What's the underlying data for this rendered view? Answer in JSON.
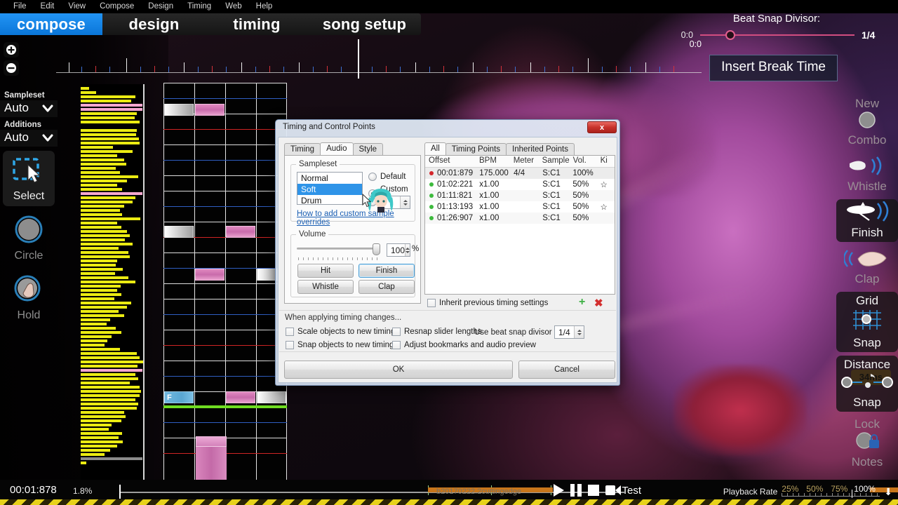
{
  "menubar": {
    "items": [
      "File",
      "Edit",
      "View",
      "Compose",
      "Design",
      "Timing",
      "Web",
      "Help"
    ]
  },
  "modes": [
    {
      "label": "compose",
      "active": true
    },
    {
      "label": "design",
      "active": false
    },
    {
      "label": "timing",
      "active": false
    },
    {
      "label": "song setup",
      "active": false
    }
  ],
  "timeline": {
    "current_time_label": "0:0"
  },
  "beat_snap": {
    "title": "Beat Snap Divisor:",
    "left_label": "0:0",
    "value": "1/4"
  },
  "break_button": {
    "label": "Insert Break Time"
  },
  "left_toolbar": {
    "sampleset_label": "Sampleset",
    "sampleset_value": "Auto",
    "additions_label": "Additions",
    "additions_value": "Auto",
    "tools": [
      {
        "name": "Select",
        "active": true
      },
      {
        "name": "Circle",
        "active": false
      },
      {
        "name": "Hold",
        "active": false
      }
    ]
  },
  "right_toolbar": {
    "items": [
      {
        "line1": "New",
        "line2": "Combo",
        "active": false
      },
      {
        "line1": "",
        "line2": "Whistle",
        "active": false
      },
      {
        "line1": "",
        "line2": "Finish",
        "active": true
      },
      {
        "line1": "",
        "line2": "Clap",
        "active": false
      },
      {
        "line1": "Grid",
        "line2": "Snap",
        "active": true
      },
      {
        "line1": "Distance",
        "line2": "Snap",
        "active": true
      },
      {
        "line1": "Lock",
        "line2": "Notes",
        "active": false
      }
    ],
    "latency_badge": "34ms"
  },
  "playfield": {
    "hold_note_label": "F"
  },
  "dialog": {
    "title": "Timing and Control Points",
    "close_label": "x",
    "left_tabs": [
      {
        "label": "Timing",
        "active": false
      },
      {
        "label": "Audio",
        "active": true
      },
      {
        "label": "Style",
        "active": false
      }
    ],
    "sampleset": {
      "legend": "Sampleset",
      "list": [
        {
          "label": "Normal",
          "selected": false
        },
        {
          "label": "Soft",
          "selected": true
        },
        {
          "label": "Drum",
          "selected": false
        }
      ],
      "radios": [
        {
          "label": "Default",
          "selected": false
        },
        {
          "label": "Custom 1",
          "selected": true
        },
        {
          "label": "",
          "selected": false
        }
      ],
      "help_link": "How to add custom sample overrides"
    },
    "volume": {
      "legend": "Volume",
      "value": "100",
      "unit": "%",
      "buttons": [
        {
          "label": "Hit",
          "highlighted": false
        },
        {
          "label": "Finish",
          "highlighted": true
        },
        {
          "label": "Whistle",
          "highlighted": false
        },
        {
          "label": "Clap",
          "highlighted": false
        }
      ]
    },
    "right_tabs": [
      {
        "label": "All",
        "active": true
      },
      {
        "label": "Timing Points",
        "active": false
      },
      {
        "label": "Inherited Points",
        "active": false
      }
    ],
    "table": {
      "headers": [
        "Offset",
        "BPM",
        "Meter",
        "Sample",
        "Vol.",
        "Ki"
      ],
      "rows": [
        {
          "marker": "red",
          "offset": "00:01:879",
          "bpm": "175.000",
          "meter": "4/4",
          "sample": "S:C1",
          "vol": "100%",
          "ki": "",
          "selected": true
        },
        {
          "marker": "green",
          "offset": "01:02:221",
          "bpm": "x1.00",
          "meter": "",
          "sample": "S:C1",
          "vol": "50%",
          "ki": "☆",
          "selected": false
        },
        {
          "marker": "green",
          "offset": "01:11:821",
          "bpm": "x1.00",
          "meter": "",
          "sample": "S:C1",
          "vol": "50%",
          "ki": "",
          "selected": false
        },
        {
          "marker": "green",
          "offset": "01:13:193",
          "bpm": "x1.00",
          "meter": "",
          "sample": "S:C1",
          "vol": "50%",
          "ki": "☆",
          "selected": false
        },
        {
          "marker": "green",
          "offset": "01:26:907",
          "bpm": "x1.00",
          "meter": "",
          "sample": "S:C1",
          "vol": "50%",
          "ki": "",
          "selected": false
        }
      ]
    },
    "inherit_checkbox": {
      "label": "Inherit previous timing settings",
      "checked": false
    },
    "add_icon": "+",
    "delete_icon": "✖",
    "apply_section": {
      "title": "When applying timing changes...",
      "checkboxes": [
        {
          "label": "Scale objects to new timing",
          "checked": false
        },
        {
          "label": "Snap objects to new timing",
          "checked": false
        },
        {
          "label": "Resnap slider lengths",
          "checked": false
        },
        {
          "label": "Adjust bookmarks and audio preview",
          "checked": false
        }
      ],
      "divisor_label": "Use beat snap divisor of",
      "divisor_value": "1/4"
    },
    "ok_label": "OK",
    "cancel_label": "Cancel"
  },
  "bottombar": {
    "time": "00:01:878",
    "percent": "1.8%",
    "song_title": "b20170222.2cuttingedge",
    "test_label": "Test",
    "playback_rate_label": "Playback Rate",
    "playback_rates": [
      "25%",
      "50%",
      "75%",
      "100%"
    ],
    "current_rate": "100%"
  },
  "colors": {
    "accent_blue": "#2295f5",
    "waveform_yellow": "#ebeb12",
    "note_pink": "#d987bd",
    "judgement_green": "#6fdd21",
    "latency_orange": "#e89b2b",
    "red_timing_point": "#d4262b",
    "green_timing_point": "#3dba3d"
  }
}
